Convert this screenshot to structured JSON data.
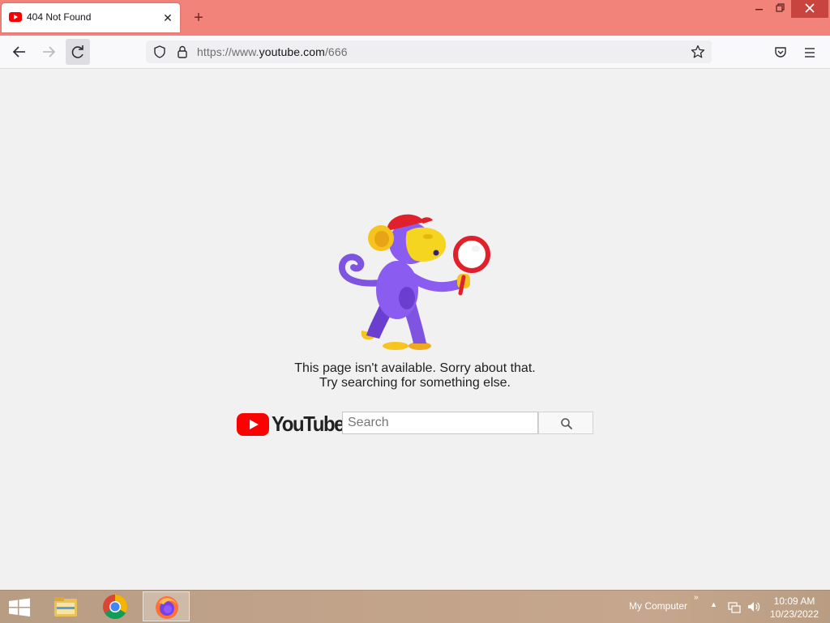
{
  "browser": {
    "tab": {
      "title": "404 Not Found",
      "favicon": "youtube-favicon-icon"
    },
    "new_tab_label": "+",
    "close_tab_label": "✕",
    "url_prefix": "https://www.",
    "url_domain": "youtube.com",
    "url_path": "/666",
    "icons": [
      "back-arrow-icon",
      "forward-arrow-icon",
      "reload-icon",
      "shield-icon",
      "lock-icon",
      "star-icon",
      "pocket-icon",
      "menu-icon"
    ],
    "accent": "#f2837a"
  },
  "page": {
    "message_line1": "This page isn't available. Sorry about that.",
    "message_line2": "Try searching for something else.",
    "logo_text": "YouTube",
    "search": {
      "placeholder": "Search",
      "value": ""
    },
    "colors": {
      "brand_red": "#ff0000",
      "background": "#f1f1f1"
    }
  },
  "taskbar": {
    "toolbar_label": "My Computer",
    "toolbar_chevron": "»",
    "tray_arrow": "▲",
    "time": "10:09 AM",
    "date": "10/23/2022",
    "apps": [
      "file-explorer-icon",
      "chrome-icon",
      "firefox-icon"
    ]
  }
}
